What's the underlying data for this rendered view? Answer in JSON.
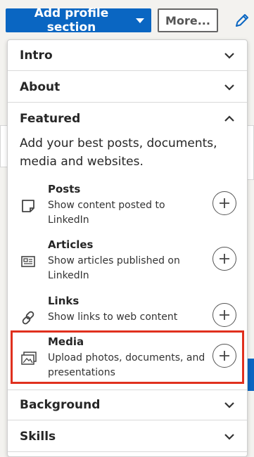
{
  "toolbar": {
    "add_section_label": "Add profile section",
    "more_label": "More..."
  },
  "sections": {
    "intro": "Intro",
    "about": "About",
    "featured": "Featured",
    "background": "Background",
    "skills": "Skills"
  },
  "featured": {
    "description": "Add your best posts, documents, media and websites.",
    "items": [
      {
        "title": "Posts",
        "description": "Show content posted to LinkedIn",
        "icon": "post-icon"
      },
      {
        "title": "Articles",
        "description": "Show articles published on LinkedIn",
        "icon": "article-icon"
      },
      {
        "title": "Links",
        "description": "Show links to web content",
        "icon": "link-icon"
      },
      {
        "title": "Media",
        "description": "Upload photos, documents, and presentations",
        "icon": "media-icon"
      }
    ]
  },
  "colors": {
    "primary": "#0a66c2",
    "highlight": "#e0301e"
  }
}
